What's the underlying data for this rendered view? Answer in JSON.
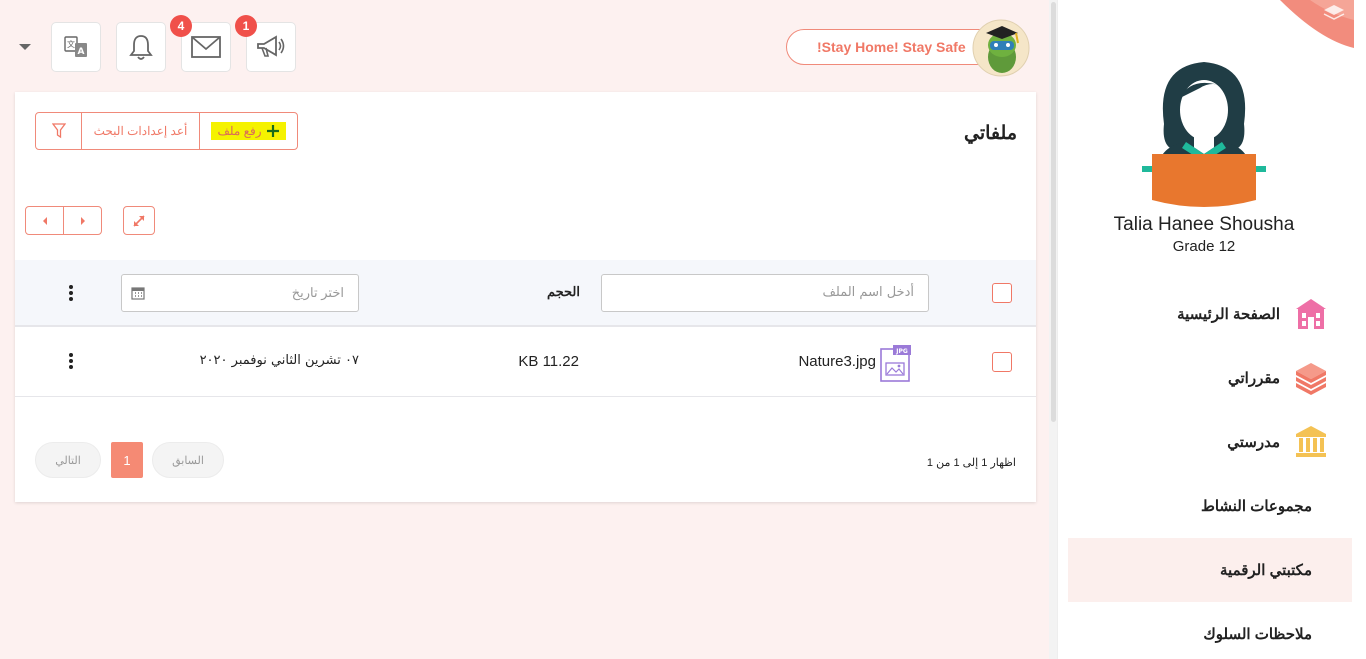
{
  "header": {
    "banner_text": "!Stay Home! Stay Safe",
    "announcements_badge": "1",
    "messages_badge": "4"
  },
  "sidebar": {
    "user_name": "Talia Hanee Shousha",
    "user_grade": "Grade 12",
    "items": [
      {
        "label": "الصفحة الرئيسية",
        "icon": "school-building-icon",
        "color": "#ee6fa6"
      },
      {
        "label": "مقرراتي",
        "icon": "books-stack-icon",
        "color": "#f07866"
      },
      {
        "label": "مدرستي",
        "icon": "institution-columns-icon",
        "color": "#f4c254"
      },
      {
        "label": "مجموعات النشاط"
      },
      {
        "label": "مكتبتي الرقمية",
        "active": true
      },
      {
        "label": "ملاحظات السلوك"
      }
    ]
  },
  "main": {
    "title": "ملفاتي",
    "toolbar": {
      "upload_label": "رفع ملف",
      "reset_label": "أعد إعدادات البحث"
    },
    "table": {
      "name_placeholder": "أدخل اسم الملف",
      "size_header": "الحجم",
      "date_placeholder": "اختر تاريخ",
      "rows": [
        {
          "name": "Nature3.jpg",
          "file_type": "JPG",
          "size": "KB 11.22",
          "date": "٠٧ تشرين الثاني نوفمبر ٢٠٢٠"
        }
      ]
    },
    "pagination": {
      "summary": "اظهار 1 إلى 1 من 1",
      "previous_label": "السابق",
      "current_page": "1",
      "next_label": "التالي"
    }
  },
  "colors": {
    "accent": "#f07866",
    "badge": "#f0504a",
    "highlight": "#f5f200",
    "background": "#fdf1f0"
  }
}
